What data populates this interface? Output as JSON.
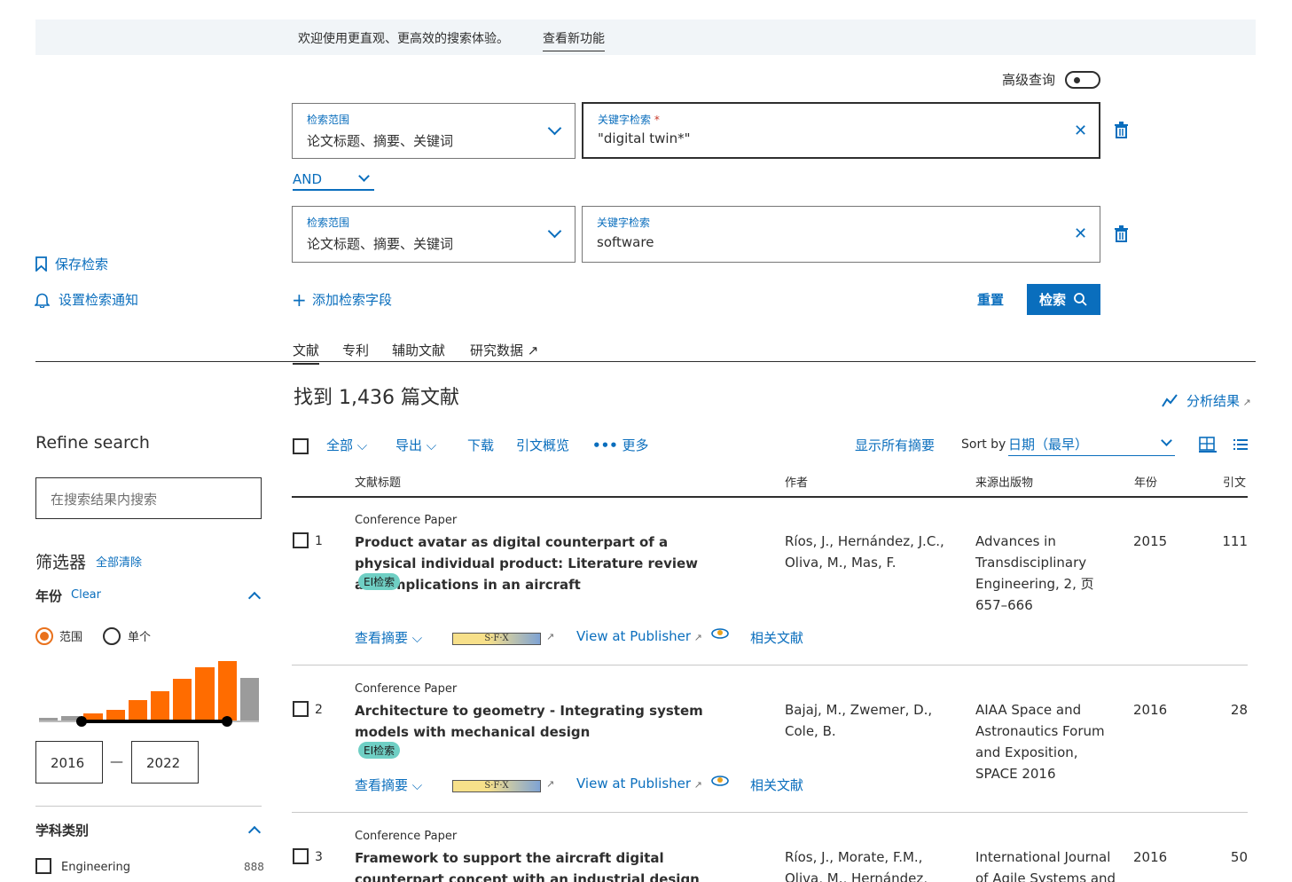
{
  "banner": {
    "text": "欢迎使用更直观、更高效的搜索体验。",
    "link": "查看新功能"
  },
  "advanced": {
    "label": "高级查询"
  },
  "rows": [
    {
      "scope_label": "检索范围",
      "scope_value": "论文标题、摘要、关键词",
      "kw_label": "关键字检索",
      "kw_required": "*",
      "kw_value": "\"digital twin*\""
    },
    {
      "scope_label": "检索范围",
      "scope_value": "论文标题、摘要、关键词",
      "kw_label": "关键字检索",
      "kw_value": "software"
    }
  ],
  "operator": "AND",
  "left_actions": {
    "save": "保存检索",
    "alert": "设置检索通知"
  },
  "add_field": "添加检索字段",
  "reset": "重置",
  "search_btn": "检索",
  "tabs": [
    "文献",
    "专利",
    "辅助文献",
    "研究数据"
  ],
  "results_title": "找到 1,436 篇文献",
  "analyze": "分析结果",
  "refine": {
    "title": "Refine search",
    "placeholder": "在搜索结果内搜索",
    "filters": "筛选器",
    "clear_all": "全部清除",
    "year_label": "年份",
    "year_clear": "Clear",
    "range": "范围",
    "single": "单个",
    "year_from": "2016",
    "year_to": "2022",
    "dash": "—",
    "subject_label": "学科类别",
    "subjects": [
      {
        "name": "Engineering",
        "count": "888"
      }
    ]
  },
  "year_histogram": {
    "values_relative": [
      0.05,
      0.08,
      0.12,
      0.18,
      0.35,
      0.5,
      0.7,
      0.9,
      1.0,
      0.72
    ],
    "selected_from": 2,
    "selected_to": 8
  },
  "toolbar": {
    "all": "全部",
    "export": "导出",
    "download": "下载",
    "citation": "引文概览",
    "more": "更多",
    "show_abstracts": "显示所有摘要",
    "sort_by": "Sort by",
    "sort_value": "日期（最早）"
  },
  "columns": {
    "title": "文献标题",
    "authors": "作者",
    "source": "来源出版物",
    "year": "年份",
    "cited": "引文"
  },
  "results": [
    {
      "n": "1",
      "type": "Conference Paper",
      "title": "Product avatar as digital counterpart of a physical individual product: Literature review and implications in an aircraft",
      "badge": "EI检索",
      "authors": "Ríos, J., Hernández, J.C., Oliva, M., Mas, F.",
      "source": "Advances in Transdisciplinary Engineering, 2, 页 657–666",
      "year": "2015",
      "cited": "111"
    },
    {
      "n": "2",
      "type": "Conference Paper",
      "title": "Architecture to geometry - Integrating system models with mechanical design",
      "badge": "EI检索",
      "authors": "Bajaj, M., Zwemer, D., Cole, B.",
      "source": "AIAA Space and Astronautics Forum and Exposition, SPACE 2016",
      "year": "2016",
      "cited": "28"
    },
    {
      "n": "3",
      "type": "Conference Paper",
      "title": "Framework to support the aircraft digital counterpart concept with an industrial design view",
      "badge": "",
      "authors": "Ríos, J., Morate, F.M., Oliva, M., Hernández, J.C.",
      "source": "International Journal of Agile Systems and",
      "year": "2016",
      "cited": "50"
    }
  ],
  "row_actions": {
    "abstract": "查看摘要",
    "sfx": "S·F·X",
    "publisher": "View at Publisher",
    "related": "相关文献"
  }
}
